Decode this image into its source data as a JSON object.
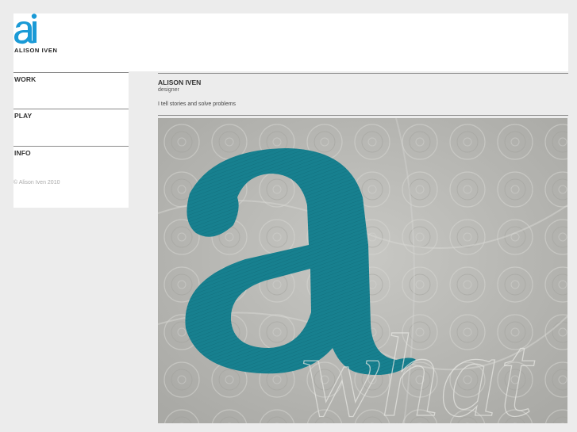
{
  "header": {
    "logo_text": "ALISON IVEN"
  },
  "sidebar": {
    "nav": [
      {
        "label": "WORK"
      },
      {
        "label": "PLAY"
      },
      {
        "label": "INFO"
      }
    ],
    "copyright": "© Alison Iven 2010"
  },
  "main": {
    "name": "ALISON IVEN",
    "role": "designer",
    "tagline": "I tell stories and solve problems",
    "hero_overlay_text": "what"
  },
  "colors": {
    "brand_blue": "#1a9ad6",
    "thread_teal": "#17808f",
    "fabric": "#bdbdb9"
  }
}
